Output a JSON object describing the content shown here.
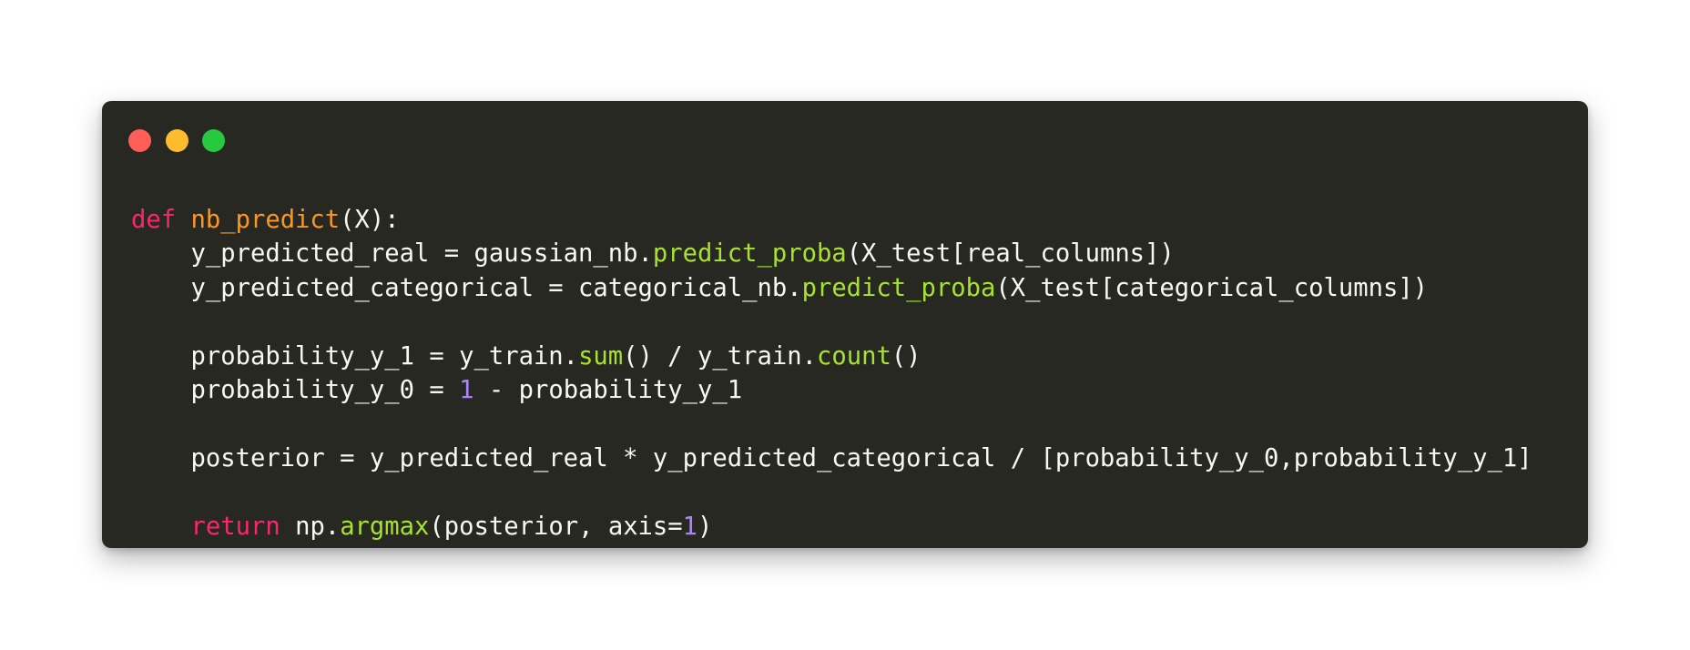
{
  "colors": {
    "window_background": "#272822",
    "page_background": "#ffffff",
    "dot_close": "#ff5f56",
    "dot_minimize": "#ffbd2e",
    "dot_maximize": "#27c93f",
    "default_text": "#f8f8f2",
    "keyword": "#f92672",
    "function_name": "#fd971f",
    "method_call": "#a6e22e",
    "number": "#ae81ff"
  },
  "code": {
    "language": "python",
    "lines": [
      [
        {
          "t": "def",
          "c": "kw"
        },
        {
          "t": " ",
          "c": "txt"
        },
        {
          "t": "nb_predict",
          "c": "fn"
        },
        {
          "t": "(X):",
          "c": "txt"
        }
      ],
      [
        {
          "t": "    y_predicted_real = gaussian_nb.",
          "c": "txt"
        },
        {
          "t": "predict_proba",
          "c": "call"
        },
        {
          "t": "(X_test[real_columns])",
          "c": "txt"
        }
      ],
      [
        {
          "t": "    y_predicted_categorical = categorical_nb.",
          "c": "txt"
        },
        {
          "t": "predict_proba",
          "c": "call"
        },
        {
          "t": "(X_test[categorical_columns])",
          "c": "txt"
        }
      ],
      [],
      [
        {
          "t": "    probability_y_1 = y_train.",
          "c": "txt"
        },
        {
          "t": "sum",
          "c": "call"
        },
        {
          "t": "() / y_train.",
          "c": "txt"
        },
        {
          "t": "count",
          "c": "call"
        },
        {
          "t": "()",
          "c": "txt"
        }
      ],
      [
        {
          "t": "    probability_y_0 = ",
          "c": "txt"
        },
        {
          "t": "1",
          "c": "num"
        },
        {
          "t": " - probability_y_1",
          "c": "txt"
        }
      ],
      [],
      [
        {
          "t": "    posterior = y_predicted_real * y_predicted_categorical / [probability_y_0,probability_y_1]",
          "c": "txt"
        }
      ],
      [],
      [
        {
          "t": "    ",
          "c": "txt"
        },
        {
          "t": "return",
          "c": "kw"
        },
        {
          "t": " np.",
          "c": "txt"
        },
        {
          "t": "argmax",
          "c": "call"
        },
        {
          "t": "(posterior, axis=",
          "c": "txt"
        },
        {
          "t": "1",
          "c": "num"
        },
        {
          "t": ")",
          "c": "txt"
        }
      ]
    ]
  }
}
